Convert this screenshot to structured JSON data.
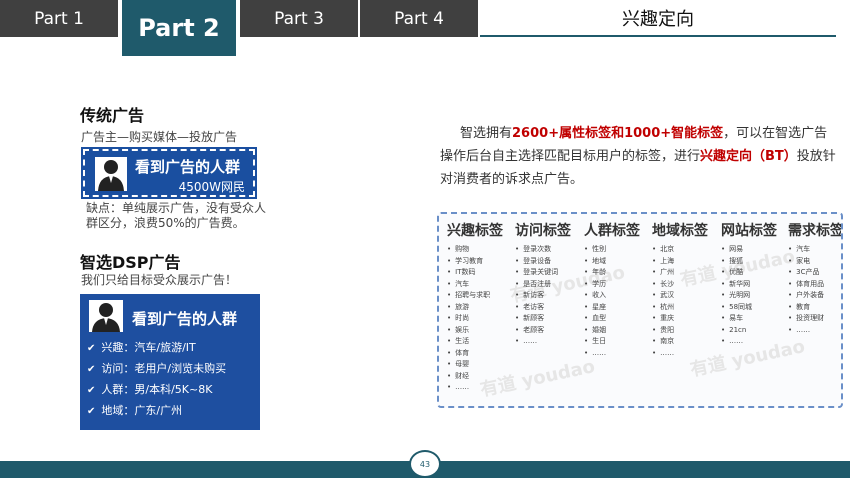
{
  "tabs": [
    "Part 1",
    "Part 2",
    "Part 3",
    "Part 4"
  ],
  "page_title": "兴趣定向",
  "left": {
    "traditional": {
      "title": "传统广告",
      "subtitle": "广告主—购买媒体—投放广告",
      "card_head": "看到广告的人群",
      "card_sub": "4500W网民",
      "drawback_1": "缺点：单纯展示广告，没有受众人",
      "drawback_2": "群区分，浪费50%的广告费。"
    },
    "dsp": {
      "title": "智选DSP广告",
      "subtitle": "我们只给目标受众展示广告！",
      "card_head": "看到广告的人群",
      "items": [
        "兴趣：汽车/旅游/IT",
        "访问：老用户/浏览未购买",
        "人群：男/本科/5K~8K",
        "地域：广东/广州"
      ]
    }
  },
  "intro": {
    "p1": "智选拥有",
    "hl1": "2600+属性标签和1000+智能标签",
    "p2": "，可以在智选广告操作后台自主选择匹配目标用户的标签，进行",
    "hl2": "兴趣定向（BT）",
    "p3": "投放针对消费者的诉求点广告。"
  },
  "tag_columns": [
    {
      "header": "兴趣标签",
      "items": [
        "购物",
        "学习教育",
        "IT数码",
        "汽车",
        "招聘与求职",
        "旅游",
        "时尚",
        "娱乐",
        "生活",
        "体育",
        "母婴",
        "财经",
        "……"
      ]
    },
    {
      "header": "访问标签",
      "items": [
        "登录次数",
        "登录设备",
        "登录关键词",
        "是否注册",
        "新访客",
        "老访客",
        "新顾客",
        "老顾客",
        "……"
      ]
    },
    {
      "header": "人群标签",
      "items": [
        "性别",
        "地域",
        "年龄",
        "学历",
        "收入",
        "星座",
        "血型",
        "婚姻",
        "生日",
        "……"
      ]
    },
    {
      "header": "地域标签",
      "items": [
        "北京",
        "上海",
        "广州",
        "长沙",
        "武汉",
        "杭州",
        "重庆",
        "贵阳",
        "南京",
        "……"
      ]
    },
    {
      "header": "网站标签",
      "items": [
        "网易",
        "搜狐",
        "优酷",
        "新华网",
        "光明网",
        "58同城",
        "易车",
        "21cn",
        "……"
      ]
    },
    {
      "header": "需求标签",
      "items": [
        "汽车",
        "家电",
        "3C产品",
        "体育用品",
        "户外装备",
        "教育",
        "投资理财",
        "……"
      ]
    }
  ],
  "watermark": "有道 youdao",
  "page_number": "43"
}
